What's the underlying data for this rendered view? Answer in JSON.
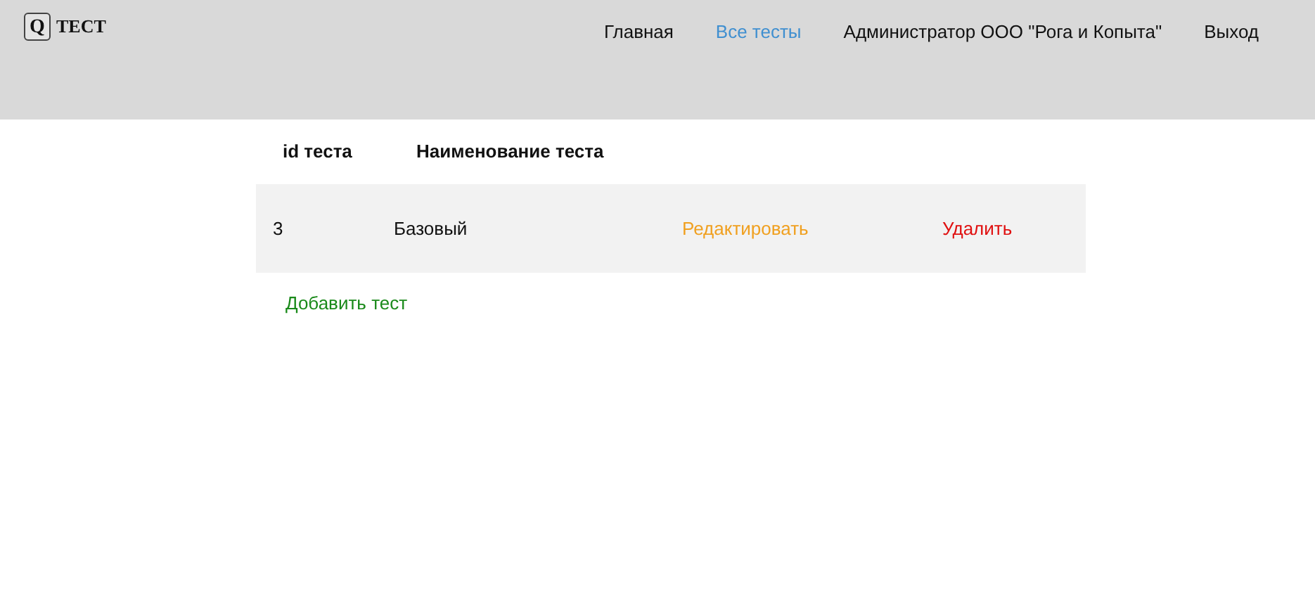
{
  "logo": {
    "mark": "Q",
    "title": "ТЕСТ"
  },
  "nav": [
    {
      "label": "Главная",
      "selected": false
    },
    {
      "label": "Все тесты",
      "selected": true
    },
    {
      "label": "Администратор ООО \"Рога и Копыта\"",
      "selected": false
    },
    {
      "label": "Выход",
      "selected": false
    }
  ],
  "table": {
    "columns": [
      "id теста",
      "Наименование теста"
    ],
    "rows": [
      {
        "id": "3",
        "name": "Базовый",
        "edit": "Редактировать",
        "delete": "Удалить"
      }
    ]
  },
  "add_link": "Добавить тест"
}
